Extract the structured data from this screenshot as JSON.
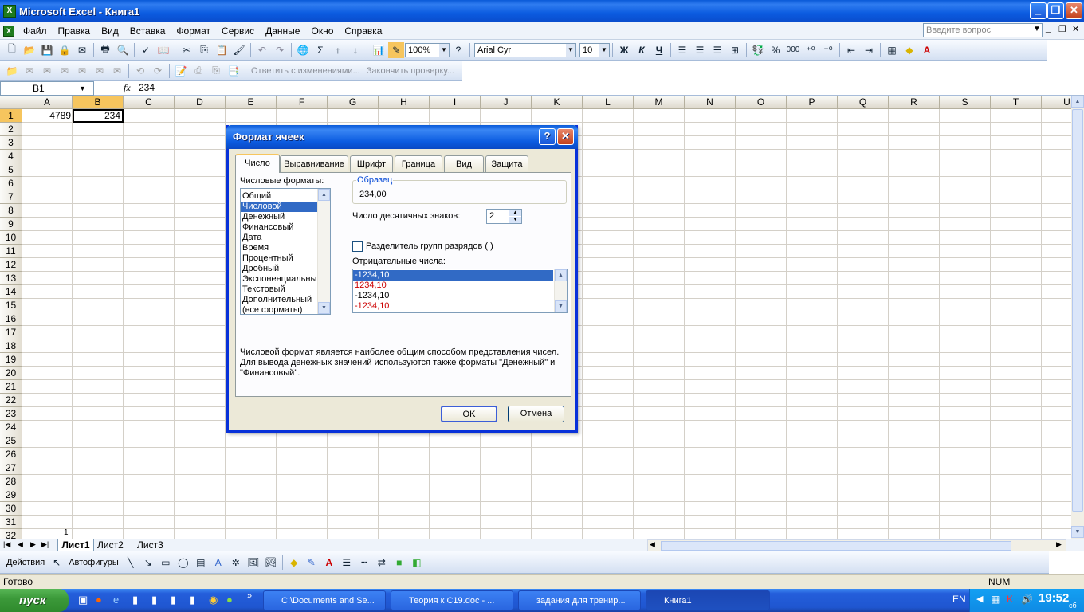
{
  "app": {
    "title": "Microsoft Excel - Книга1",
    "icon": "excel-icon"
  },
  "menu": {
    "items": [
      "Файл",
      "Правка",
      "Вид",
      "Вставка",
      "Формат",
      "Сервис",
      "Данные",
      "Окно",
      "Справка"
    ],
    "ask_placeholder": "Введите вопрос"
  },
  "toolbar": {
    "zoom": "100%",
    "font": "Arial Cyr",
    "size": "10",
    "bold": "Ж",
    "italic": "К",
    "underline": "Ч",
    "percent": "%",
    "thousands": "000",
    "review_reply": "Ответить с изменениями...",
    "review_end": "Закончить проверку..."
  },
  "formula": {
    "cell": "B1",
    "fx": "fx",
    "value": "234"
  },
  "grid": {
    "columns": [
      "A",
      "B",
      "C",
      "D",
      "E",
      "F",
      "G",
      "H",
      "I",
      "J",
      "K",
      "L",
      "M",
      "N",
      "O",
      "P",
      "Q",
      "R",
      "S",
      "T",
      "U"
    ],
    "rows": [
      "1",
      "2",
      "3",
      "4",
      "5",
      "6",
      "7",
      "8",
      "9",
      "10",
      "11",
      "12",
      "13",
      "14",
      "15",
      "16",
      "17",
      "18",
      "19",
      "20",
      "21",
      "22",
      "23",
      "24",
      "25",
      "26",
      "27",
      "28",
      "29",
      "30",
      "31",
      "32"
    ],
    "a1": "4789",
    "b1": "234",
    "stray": "1"
  },
  "sheets": [
    "Лист1",
    "Лист2",
    "Лист3"
  ],
  "drawing": {
    "actions": "Действия",
    "autoshapes": "Автофигуры"
  },
  "status": {
    "ready": "Готово",
    "num": "NUM"
  },
  "taskbar": {
    "start": "пуск",
    "tasks": [
      "C:\\Documents and Se...",
      "Теория к С19.doc - ...",
      "задания для тренир...",
      "Книга1"
    ],
    "lang": "EN",
    "time": "19:52",
    "day": "сб"
  },
  "dialog": {
    "title": "Формат ячеек",
    "tabs": [
      "Число",
      "Выравнивание",
      "Шрифт",
      "Граница",
      "Вид",
      "Защита"
    ],
    "formats_label": "Числовые форматы:",
    "formats": [
      "Общий",
      "Числовой",
      "Денежный",
      "Финансовый",
      "Дата",
      "Время",
      "Процентный",
      "Дробный",
      "Экспоненциальный",
      "Текстовый",
      "Дополнительный",
      "(все форматы)"
    ],
    "sample_label": "Образец",
    "sample_value": "234,00",
    "decimals_label": "Число десятичных знаков:",
    "decimals_value": "2",
    "separator_label": "Разделитель групп разрядов ( )",
    "negative_label": "Отрицательные числа:",
    "negatives": [
      "-1234,10",
      "1234,10",
      "-1234,10",
      "-1234,10"
    ],
    "negative_color": "#cc0000",
    "description": "Числовой формат является наиболее общим способом представления чисел. Для вывода денежных значений используются также форматы \"Денежный\" и \"Финансовый\".",
    "ok": "OK",
    "cancel": "Отмена"
  }
}
